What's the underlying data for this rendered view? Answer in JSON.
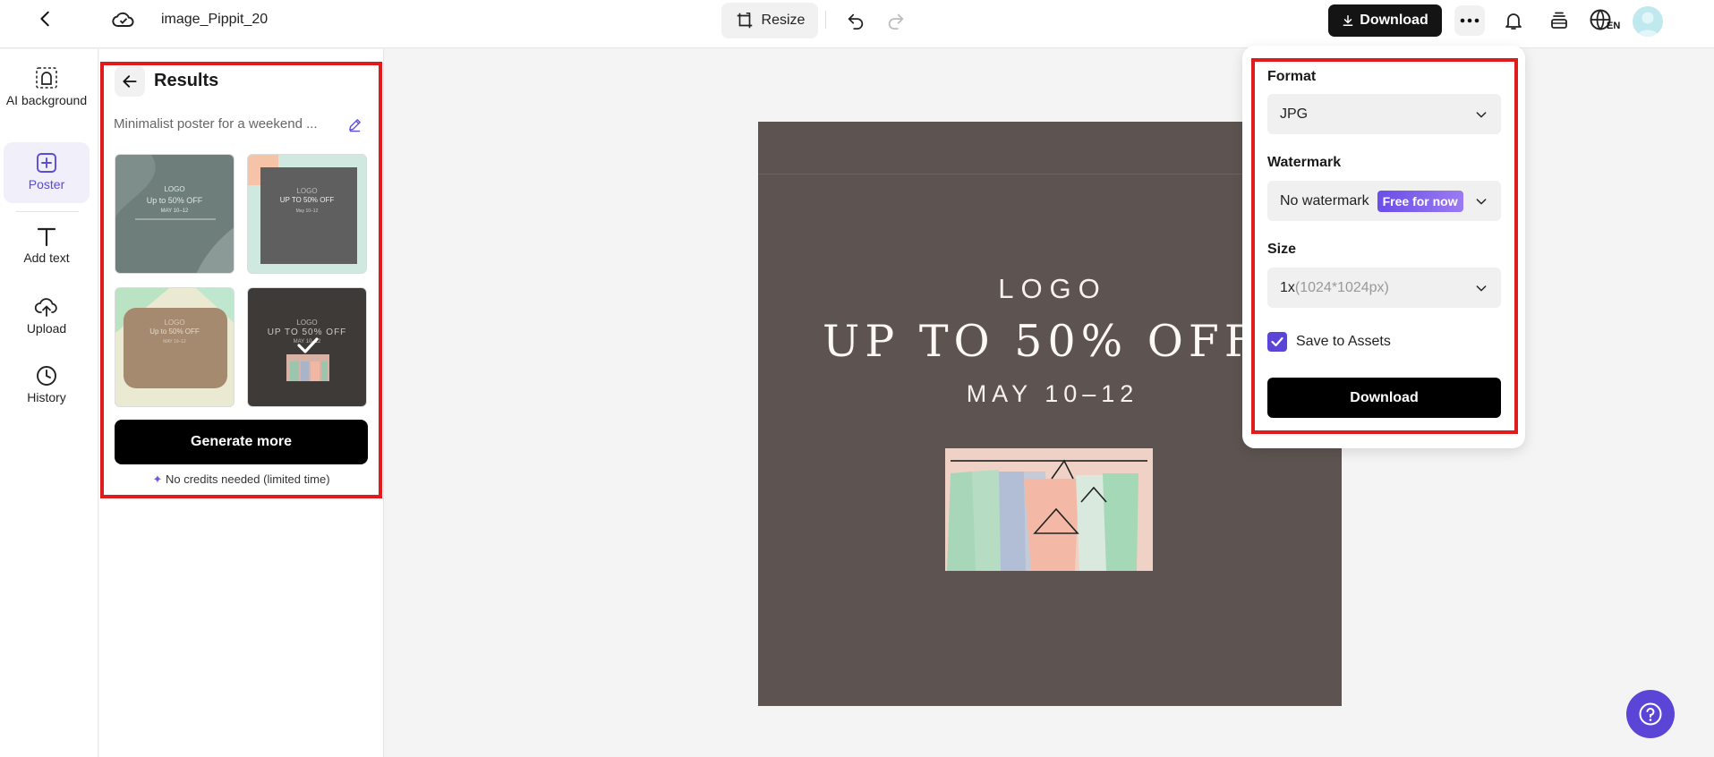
{
  "header": {
    "file_title": "image_Pippit_20",
    "resize_label": "Resize",
    "download_label": "Download",
    "language_code": "EN"
  },
  "sidebar": {
    "items": [
      {
        "label": "AI background",
        "icon": "ai-background-icon"
      },
      {
        "label": "Poster",
        "icon": "poster-icon",
        "active": true
      },
      {
        "label": "Add text",
        "icon": "text-icon"
      },
      {
        "label": "Upload",
        "icon": "upload-icon"
      },
      {
        "label": "History",
        "icon": "history-icon"
      }
    ]
  },
  "results": {
    "title": "Results",
    "prompt": "Minimalist poster for a weekend ...",
    "thumbnails": [
      {
        "line1": "LOGO",
        "line2": "Up to 50% OFF",
        "line3": "MAY 10–12",
        "selected": false
      },
      {
        "line1": "LOGO",
        "line2": "UP TO 50% OFF",
        "line3": "May 10–12",
        "selected": false
      },
      {
        "line1": "LOGO",
        "line2": "Up to 50% OFF",
        "line3": "MAY 10–12",
        "selected": false
      },
      {
        "line1": "LOGO",
        "line2": "UP TO 50% OFF",
        "line3": "MAY 10–12",
        "selected": true
      }
    ],
    "generate_label": "Generate more",
    "credits_note": "No credits needed (limited time)"
  },
  "canvas": {
    "logo": "LOGO",
    "headline": "UP TO 50% OFF",
    "date": "MAY 10–12"
  },
  "download_panel": {
    "format_label": "Format",
    "format_value": "JPG",
    "watermark_label": "Watermark",
    "watermark_value": "No watermark",
    "watermark_badge": "Free for now",
    "size_label": "Size",
    "size_value": "1x",
    "size_hint": "(1024*1024px)",
    "save_to_assets_label": "Save to Assets",
    "save_to_assets_checked": true,
    "download_label": "Download"
  },
  "colors": {
    "accent": "#5b45d6",
    "highlight_box": "#e01b1b",
    "poster_bg": "#5d5451"
  }
}
